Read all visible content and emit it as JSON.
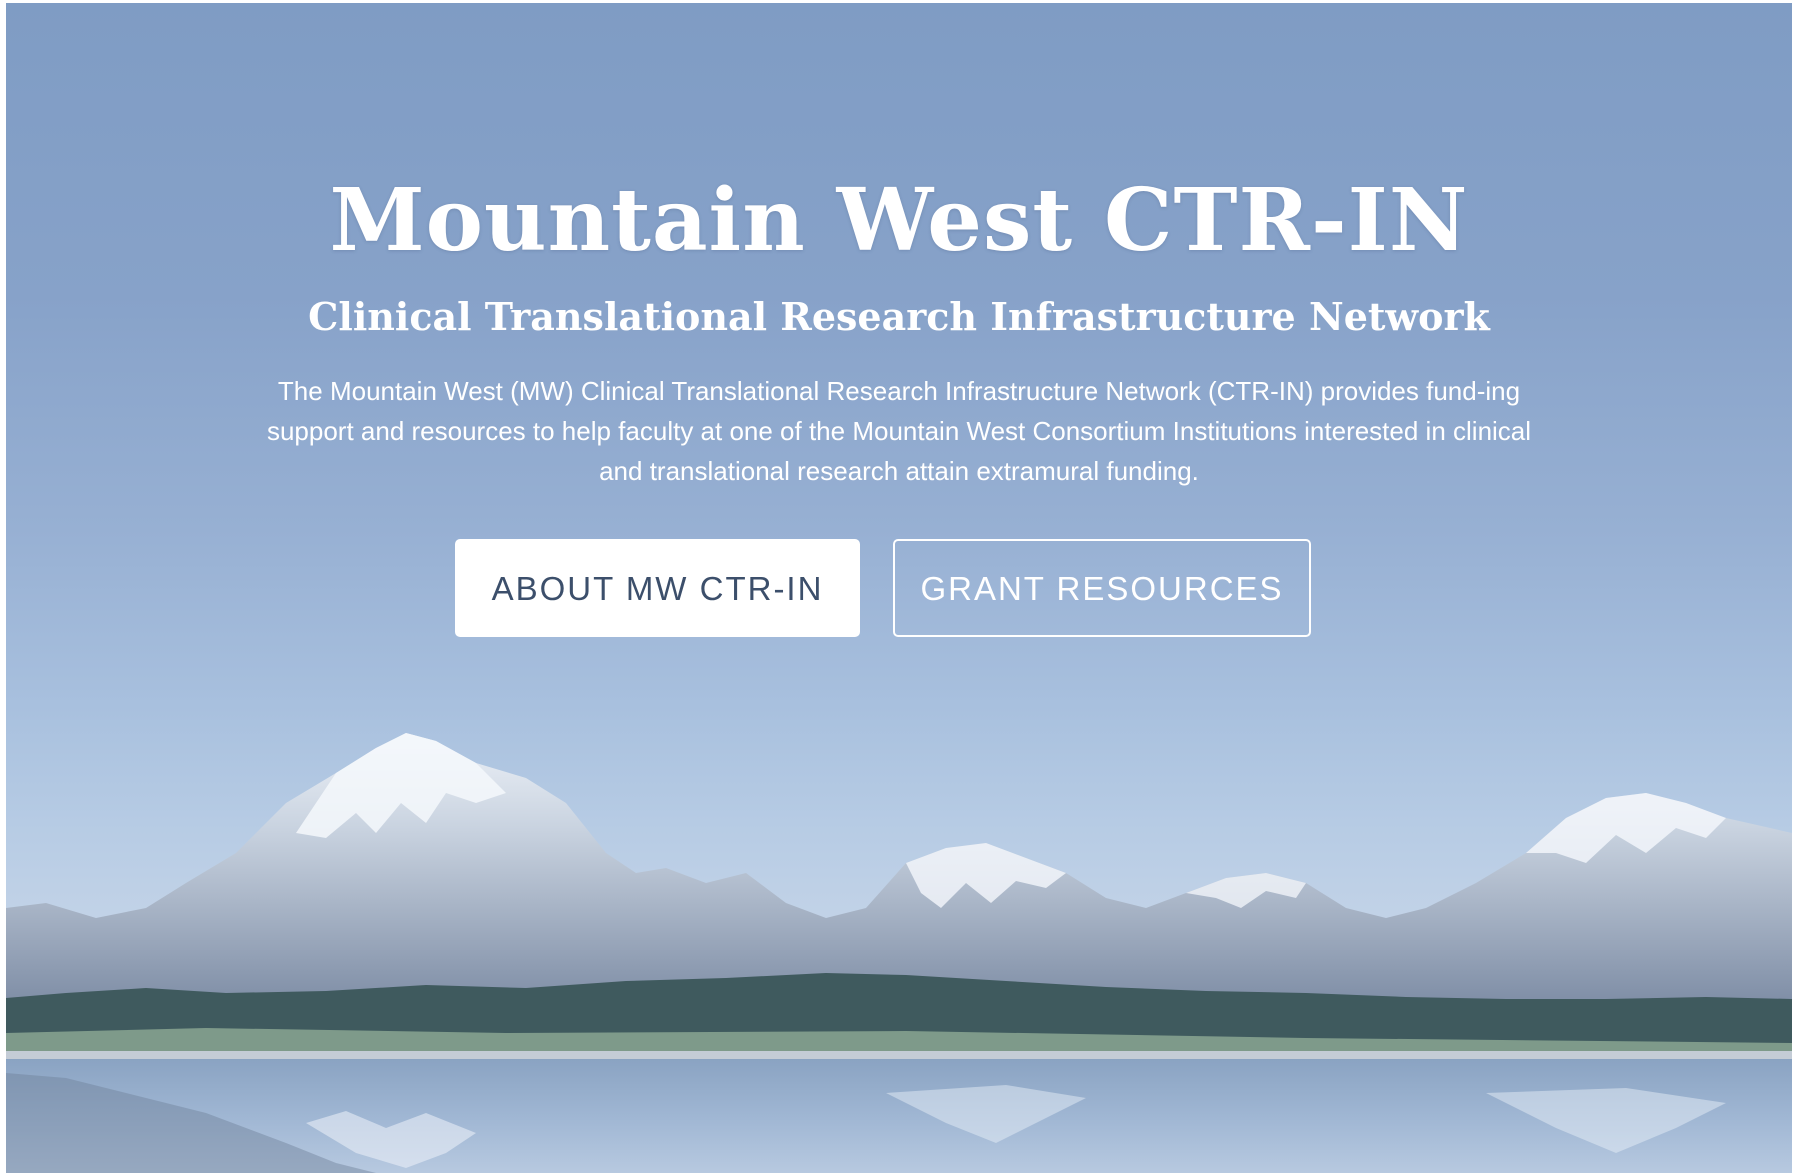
{
  "hero": {
    "title": "Mountain West CTR-IN",
    "subtitle": "Clinical Translational Research Infrastructure Network",
    "description": "The Mountain West (MW) Clinical Translational Research Infrastructure Network (CTR-IN) provides fund-ing support and resources to help faculty at one of the Mountain West Consortium Institutions interested in clinical and translational research attain extramural funding.",
    "buttons": {
      "about_label": "ABOUT MW CTR-IN",
      "grants_label": "GRANT RESOURCES"
    },
    "colors": {
      "sky": "#87a2c9",
      "button_text": "#3c4f6b",
      "text": "#ffffff"
    }
  }
}
